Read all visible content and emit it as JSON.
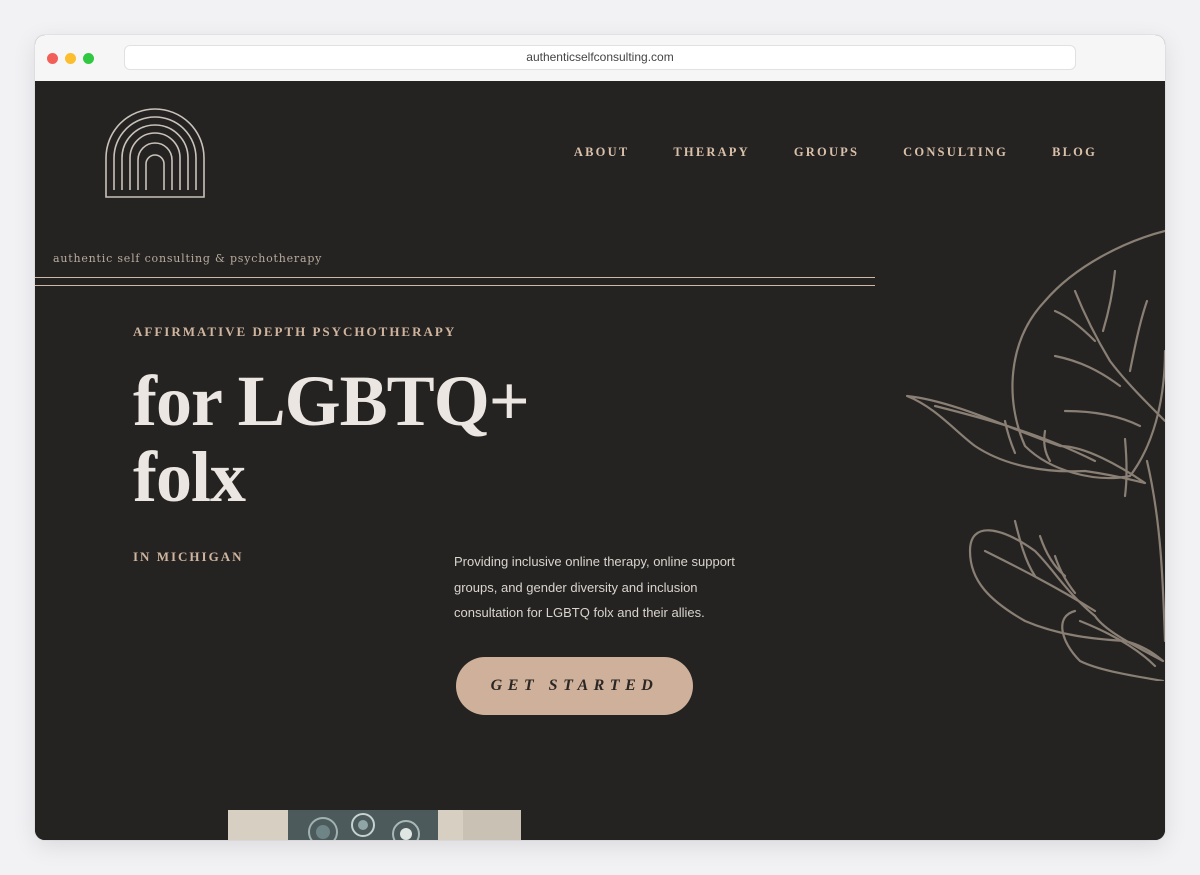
{
  "browser": {
    "url": "authenticselfconsulting.com"
  },
  "nav": {
    "items": [
      "ABOUT",
      "THERAPY",
      "GROUPS",
      "CONSULTING",
      "BLOG"
    ]
  },
  "brand": {
    "tagline": "authentic self consulting & psychotherapy"
  },
  "hero": {
    "eyebrow": "AFFIRMATIVE DEPTH PSYCHOTHERAPY",
    "headline_line1": "for LGBTQ+",
    "headline_line2": "folx",
    "location": "IN MICHIGAN",
    "description": "Providing inclusive online therapy, online support groups, and gender diversity and inclusion consultation for LGBTQ folx and their allies.",
    "cta_label": "GET STARTED"
  },
  "colors": {
    "background": "#242321",
    "accent": "#cfb09b",
    "nav_text": "#d9c0aa",
    "headline": "#ebe6e1"
  }
}
